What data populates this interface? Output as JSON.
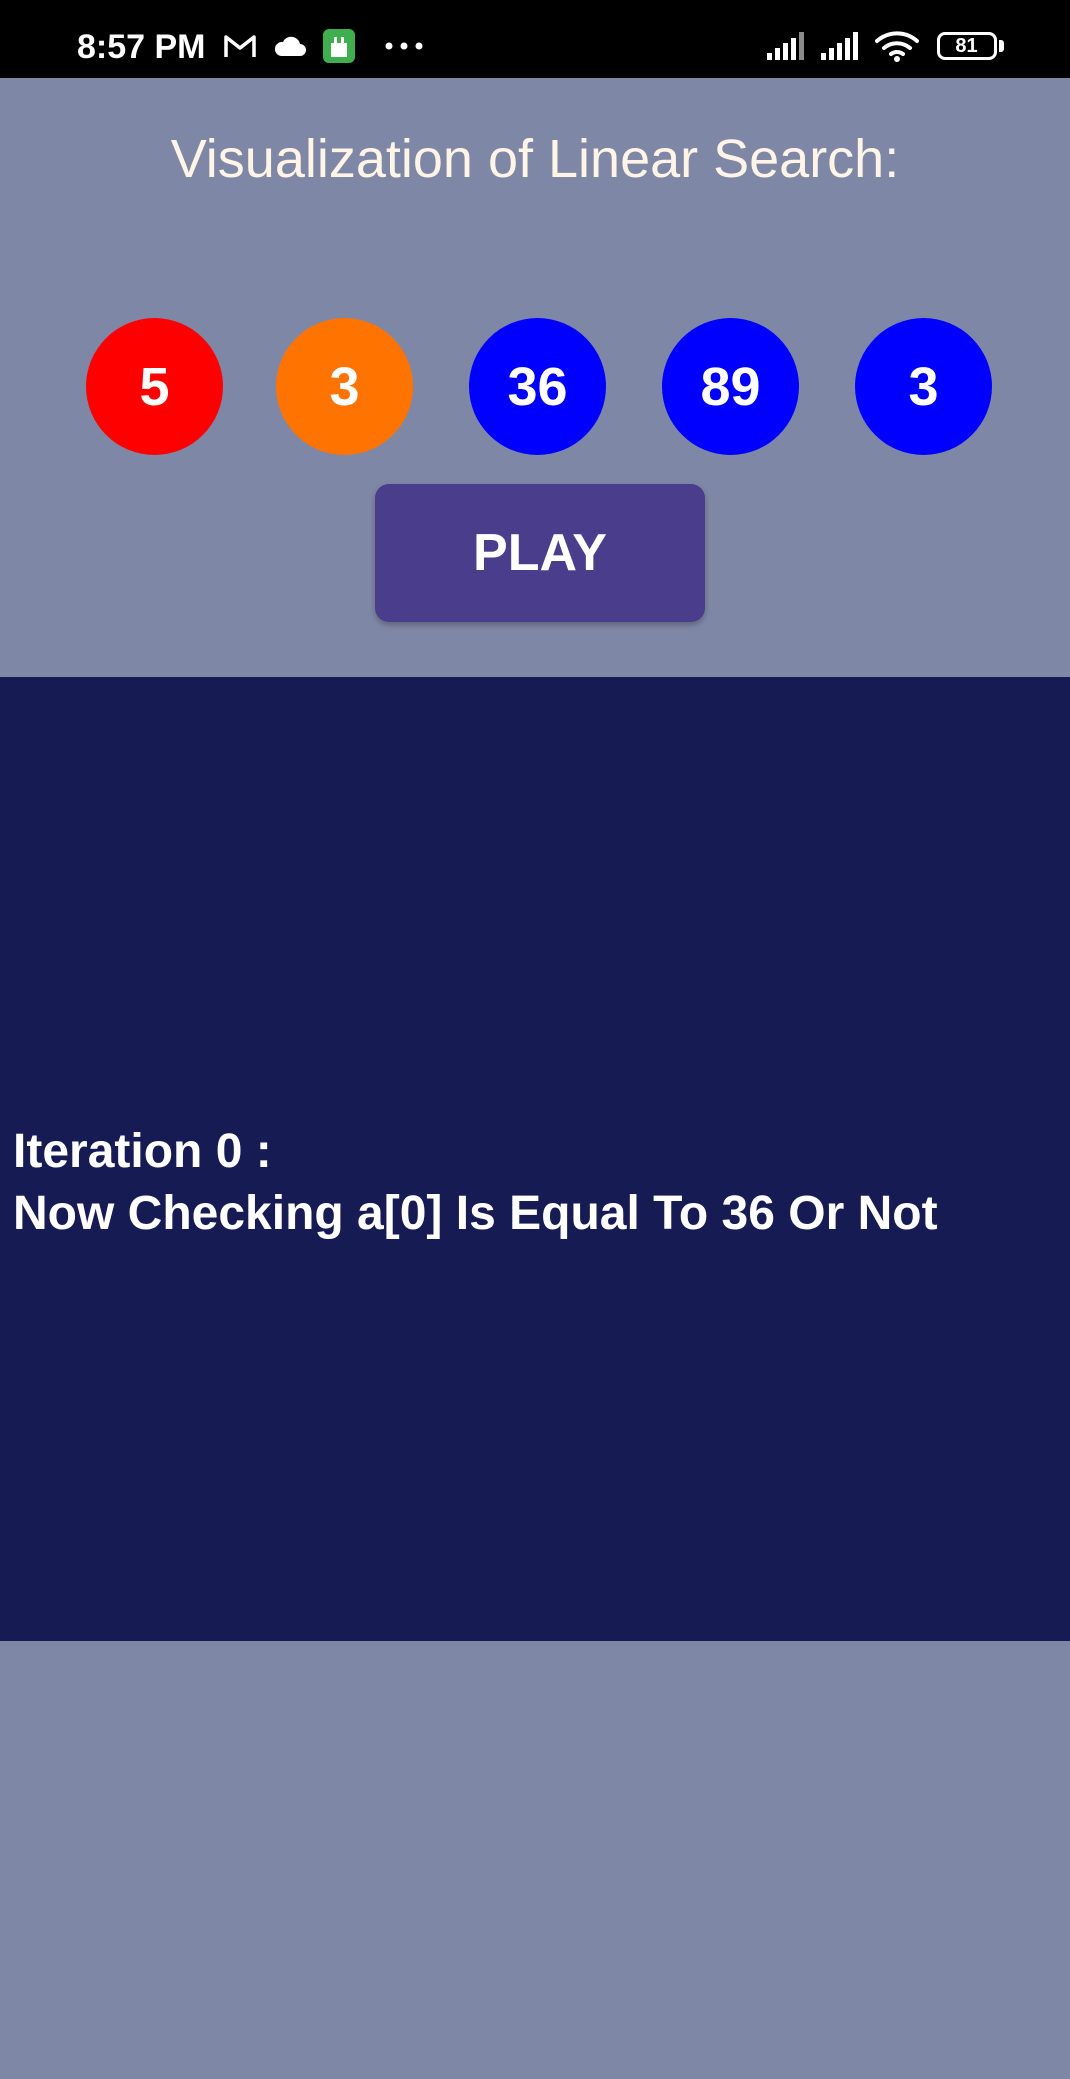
{
  "status_bar": {
    "time": "8:57 PM",
    "battery_level": "81",
    "icons": [
      "gmail-icon",
      "cloud-icon",
      "app-icon",
      "more-dots-icon",
      "signal-icon",
      "signal-icon",
      "wifi-icon",
      "battery-icon"
    ]
  },
  "title": "Visualization of Linear Search:",
  "array": [
    {
      "value": "5",
      "color": "#ff0000"
    },
    {
      "value": "3",
      "color": "#ff7300"
    },
    {
      "value": "36",
      "color": "#0000ff"
    },
    {
      "value": "89",
      "color": "#0000ff"
    },
    {
      "value": "3",
      "color": "#0000ff"
    }
  ],
  "play_button": {
    "label": "PLAY"
  },
  "output": {
    "line1": "Iteration 0 :",
    "line2": "Now Checking a[0] Is Equal To 36 Or Not"
  },
  "colors": {
    "background": "#7f87a6",
    "panel": "#171b54",
    "button": "#4a3d8c",
    "title_text": "#fff4e6"
  }
}
